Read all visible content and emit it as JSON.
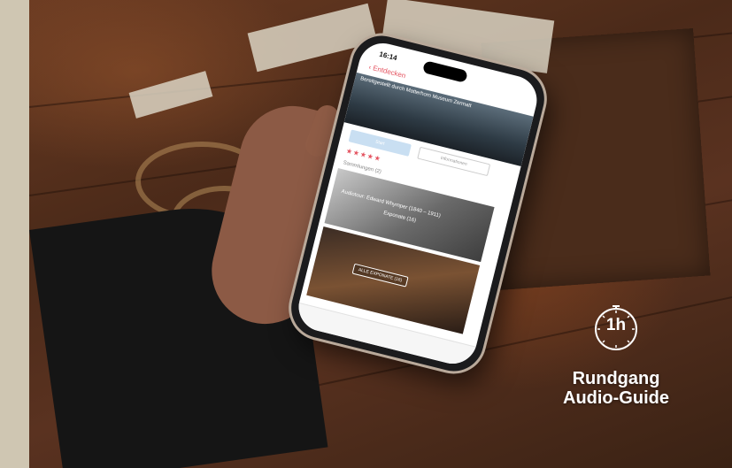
{
  "badge": {
    "duration": "1h",
    "icon": "stopwatch-icon"
  },
  "caption": {
    "line1": "Rundgang",
    "line2": "Audio-Guide"
  },
  "phone": {
    "time": "16:14",
    "back_label": "Entdecken",
    "hero_caption": "Bereitgestellt durch Matterhorn Museum Zermatt",
    "primary_button": "Start",
    "info_button": "Informationen",
    "rating_stars": "★★★★★",
    "section_title": "Sammlungen (2)",
    "card1_title": "Audiotour: Edward Whymper (1840 – 1911)",
    "card1_sub": "Exponate (16)",
    "card2_button": "ALLE EXPONATE (16)"
  },
  "colors": {
    "accent": "#e4525f",
    "strip": "#cfc6b2"
  }
}
